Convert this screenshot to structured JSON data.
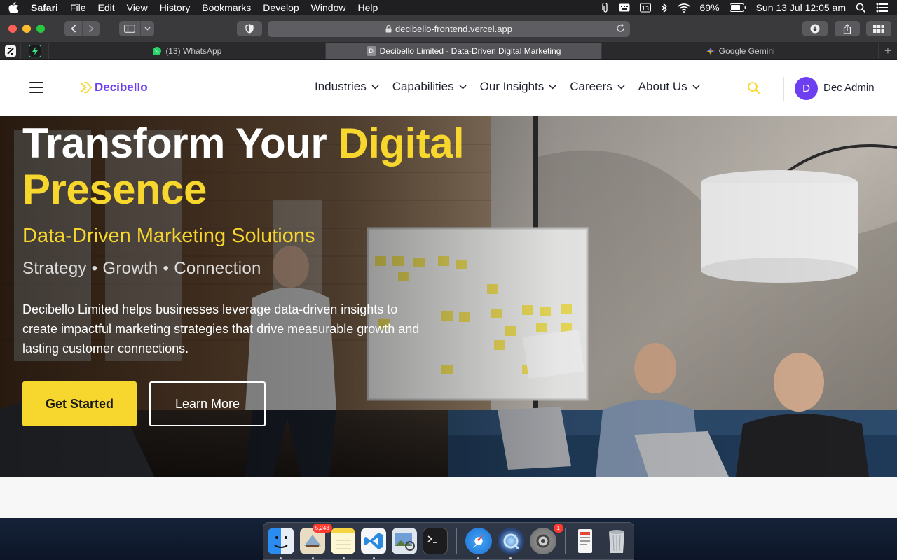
{
  "menubar": {
    "app_name": "Safari",
    "items": [
      "File",
      "Edit",
      "View",
      "History",
      "Bookmarks",
      "Develop",
      "Window",
      "Help"
    ],
    "battery": "69%",
    "datetime": "Sun 13 Jul  12:05 am"
  },
  "browser": {
    "url": "decibello-frontend.vercel.app",
    "tabs": [
      {
        "title": "(13) WhatsApp",
        "favicon": "whatsapp-icon"
      },
      {
        "title": "Decibello Limited - Data-Driven Digital Marketing",
        "favicon_letter": "D",
        "active": true
      },
      {
        "title": "Google Gemini",
        "favicon": "gemini-icon"
      }
    ]
  },
  "site": {
    "logo_text": "Decibello",
    "nav": [
      {
        "label": "Industries"
      },
      {
        "label": "Capabilities"
      },
      {
        "label": "Our Insights"
      },
      {
        "label": "Careers"
      },
      {
        "label": "About Us"
      }
    ],
    "user": {
      "initial": "D",
      "name": "Dec Admin"
    }
  },
  "hero": {
    "title_line1": "Transform Your ",
    "title_highlight1": "Digital",
    "title_highlight2": "Presence",
    "subtitle": "Data-Driven Marketing Solutions",
    "tagline": "Strategy • Growth • Connection",
    "description": "Decibello Limited helps businesses leverage data-driven insights to create impactful marketing strategies that drive measurable growth and lasting customer connections.",
    "primary_button": "Get Started",
    "secondary_button": "Learn More"
  },
  "dock": {
    "apps": [
      "finder",
      "mail",
      "notes",
      "vscode",
      "preview",
      "terminal",
      "safari",
      "quicktime",
      "system-preferences",
      "documents",
      "trash"
    ],
    "mail_badge": "5,243",
    "settings_badge": "1"
  },
  "colors": {
    "brand_purple": "#6d3ff0",
    "accent_yellow": "#f7d62e"
  }
}
